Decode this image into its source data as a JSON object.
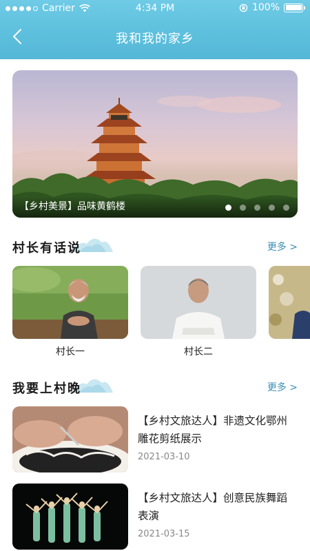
{
  "status_bar": {
    "carrier": "Carrier",
    "time": "4:34 PM",
    "battery": "100%"
  },
  "nav": {
    "title": "我和我的家乡"
  },
  "banner": {
    "caption": "【乡村美景】品味黄鹤楼",
    "dot_count": 5,
    "active_dot": 1,
    "sign_text": "黄鹤楼"
  },
  "section_heads": {
    "title": "村长有话说",
    "more": "更多 >"
  },
  "village_heads": [
    {
      "name": "村长一"
    },
    {
      "name": "村长二"
    }
  ],
  "section_gala": {
    "title": "我要上村晚",
    "more": "更多 >"
  },
  "news": [
    {
      "title": "【乡村文旅达人】非遗文化鄂州雕花剪纸展示",
      "date": "2021-03-10"
    },
    {
      "title": "【乡村文旅达人】创意民族舞蹈表演",
      "date": "2021-03-15"
    }
  ],
  "colors": {
    "header": "#5cbfdc",
    "accent_link": "#3a8fb3"
  }
}
